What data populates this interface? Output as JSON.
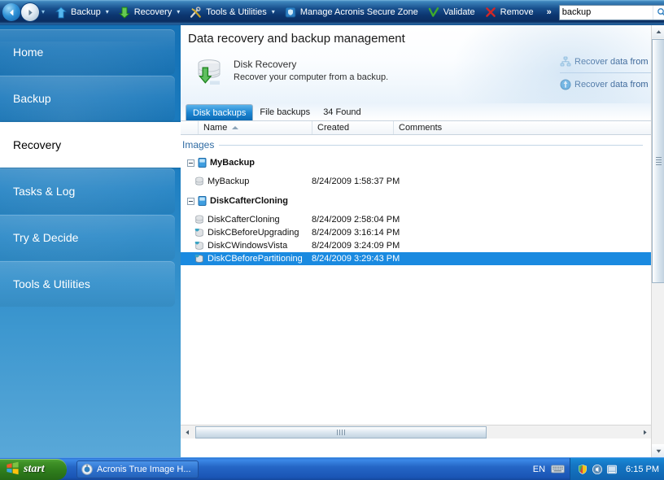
{
  "toolbar": {
    "back_icon": "back-arrow-icon",
    "forward_icon": "forward-arrow-icon",
    "history_chevron": "▾",
    "items": [
      {
        "label": "Backup",
        "icon": "blue-up-arrow-icon",
        "has_dropdown": true
      },
      {
        "label": "Recovery",
        "icon": "green-down-arrow-icon",
        "has_dropdown": true
      },
      {
        "label": "Tools & Utilities",
        "icon": "crossed-tools-icon",
        "has_dropdown": true
      },
      {
        "label": "Manage Acronis Secure Zone",
        "icon": "secure-zone-icon",
        "has_dropdown": false
      },
      {
        "label": "Validate",
        "icon": "green-check-icon",
        "has_dropdown": false
      },
      {
        "label": "Remove",
        "icon": "red-x-icon",
        "has_dropdown": false
      }
    ],
    "overflow_label": "»",
    "dropdown_arrow": "▾"
  },
  "search": {
    "value": "backup",
    "placeholder": "",
    "button_icon": "magnifier-icon"
  },
  "help": {
    "glyph": "?",
    "dropdown_arrow": "▾"
  },
  "sidebar": {
    "items": [
      {
        "label": "Home",
        "active": false
      },
      {
        "label": "Backup",
        "active": false
      },
      {
        "label": "Recovery",
        "active": true
      },
      {
        "label": "Tasks & Log",
        "active": false
      },
      {
        "label": "Try & Decide",
        "active": false
      },
      {
        "label": "Tools & Utilities",
        "active": false
      }
    ]
  },
  "main": {
    "page_title": "Data recovery and backup management",
    "hero": {
      "icon": "disk-recovery-icon",
      "title": "Disk Recovery",
      "subtitle": "Recover your computer from a backup."
    },
    "recover_links": [
      {
        "label": "Recover  data  from",
        "icon": "network-recover-icon"
      },
      {
        "label": "Recover  data  from",
        "icon": "globe-recover-icon"
      }
    ],
    "tabs": [
      {
        "label": "Disk backups",
        "active": true
      },
      {
        "label": "File backups",
        "active": false
      },
      {
        "label": "34 Found",
        "active": false,
        "is_count": true
      }
    ],
    "columns": [
      {
        "label": "Name",
        "sorted": "asc"
      },
      {
        "label": "Created",
        "sorted": ""
      },
      {
        "label": "Comments",
        "sorted": ""
      }
    ],
    "group_label": "Images",
    "rows": [
      {
        "type": "group",
        "name": "MyBackup",
        "created": "",
        "comments": "",
        "icon": "blue-disk-icon",
        "expanded": true,
        "selected": false
      },
      {
        "type": "child",
        "name": "MyBackup",
        "created": "8/24/2009 1:58:37 PM",
        "comments": "",
        "icon": "gray-archive-icon",
        "expanded": false,
        "selected": false
      },
      {
        "type": "group",
        "name": "DiskCafterCloning",
        "created": "",
        "comments": "",
        "icon": "blue-disk-icon",
        "expanded": true,
        "selected": false
      },
      {
        "type": "child",
        "name": "DiskCafterCloning",
        "created": "8/24/2009 2:58:04 PM",
        "comments": "",
        "icon": "gray-archive-icon",
        "expanded": false,
        "selected": false
      },
      {
        "type": "child",
        "name": "DiskCBeforeUpgrading",
        "created": "8/24/2009 3:16:14 PM",
        "comments": "",
        "icon": "green-archive-icon",
        "expanded": false,
        "selected": false
      },
      {
        "type": "child",
        "name": "DiskCWindowsVista",
        "created": "8/24/2009 3:24:09 PM",
        "comments": "",
        "icon": "green-archive-icon",
        "expanded": false,
        "selected": false
      },
      {
        "type": "child",
        "name": "DiskCBeforePartitioning",
        "created": "8/24/2009 3:29:43 PM",
        "comments": "",
        "icon": "green-archive-icon",
        "expanded": false,
        "selected": true
      }
    ]
  },
  "scrollbars": {
    "vertical": {
      "up_icon": "scroll-up-icon",
      "down_icon": "scroll-down-icon"
    },
    "horizontal": {
      "left_icon": "scroll-left-icon",
      "right_icon": "scroll-right-icon"
    }
  },
  "taskbar": {
    "start_label": "start",
    "start_icon": "windows-flag-icon",
    "task_button": {
      "label": "Acronis True Image H...",
      "icon": "acronis-app-icon"
    },
    "language": "EN",
    "keyboard_icon": "keyboard-icon",
    "tray_icons": [
      "security-shield-icon",
      "volume-icon",
      "network-icon"
    ],
    "clock": "6:15 PM"
  },
  "colors": {
    "accent_blue": "#1a8ae0",
    "sidebar_blue": "#1a7cc0",
    "toolbar_dark": "#0c3670",
    "link_blue": "#12437e",
    "group_label_blue": "#2f6ba3",
    "taskbar_blue": "#2566c6",
    "start_green": "#3f9127"
  }
}
